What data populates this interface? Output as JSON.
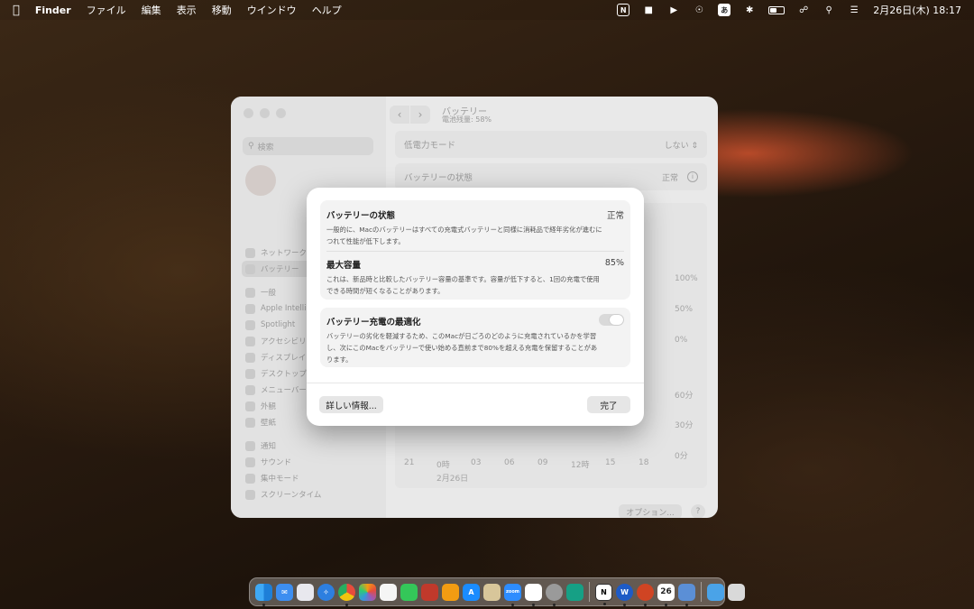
{
  "menubar": {
    "app_name": "Finder",
    "menus": [
      "ファイル",
      "編集",
      "表示",
      "移動",
      "ウインドウ",
      "ヘルプ"
    ],
    "input_method": "あ",
    "notion_badge": "N",
    "datetime": "2月26日(木)  18:17"
  },
  "settings_window": {
    "search_placeholder": "検索",
    "sidebar_items_top": [
      "ネットワーク",
      "バッテリー"
    ],
    "sidebar_items_mid": [
      "一般",
      "Apple Intelligence",
      "Spotlight",
      "アクセシビリティ",
      "ディスプレイ",
      "デスクトップ",
      "メニューバー",
      "外観",
      "壁紙"
    ],
    "sidebar_items_bottom": [
      "通知",
      "サウンド",
      "集中モード",
      "スクリーンタイム"
    ],
    "title": "バッテリー",
    "subtitle": "電池残量: 58%",
    "low_power_label": "低電力モード",
    "low_power_value": "しない",
    "battery_health_label": "バッテリーの状態",
    "battery_health_value": "正常",
    "y_ticks_top": [
      "100%",
      "50%",
      "0%"
    ],
    "y_ticks_bottom": [
      "60分",
      "30分",
      "0分"
    ],
    "x_ticks": [
      "21",
      "0時",
      "03",
      "06",
      "09",
      "12時",
      "15",
      "18"
    ],
    "date_label": "2月26日",
    "options_label": "オプション...",
    "help_label": "?"
  },
  "modal": {
    "health": {
      "title": "バッテリーの状態",
      "value": "正常",
      "description": "一般的に、Macのバッテリーはすべての充電式バッテリーと同様に消耗品で経年劣化が進むにつれて性能が低下します。"
    },
    "capacity": {
      "title": "最大容量",
      "value": "85%",
      "description": "これは、新品時と比較したバッテリー容量の基準です。容量が低下すると、1回の充電で使用できる時間が短くなることがあります。"
    },
    "optimize": {
      "title": "バッテリー充電の最適化",
      "enabled": true,
      "description": "バッテリーの劣化を軽減するため、このMacが日ごろのどのように充電されているかを学習し、次にこのMacをバッテリーで使い始める直前まで80%を超える充電を保留することがあります。"
    },
    "more_info_label": "詳しい情報...",
    "done_label": "完了"
  },
  "dock": {
    "calendar_day": "26",
    "apps": [
      "finder",
      "mail",
      "launchpad",
      "safari",
      "chrome",
      "photos",
      "calculator",
      "numbers",
      "mosaic",
      "pages",
      "app-store",
      "preview",
      "zoom",
      "slack",
      "system-settings",
      "chatgpt",
      "notion",
      "word",
      "powerpoint",
      "calendar",
      "finder-2",
      "folder",
      "trash"
    ],
    "zoom_label": "zoom"
  }
}
